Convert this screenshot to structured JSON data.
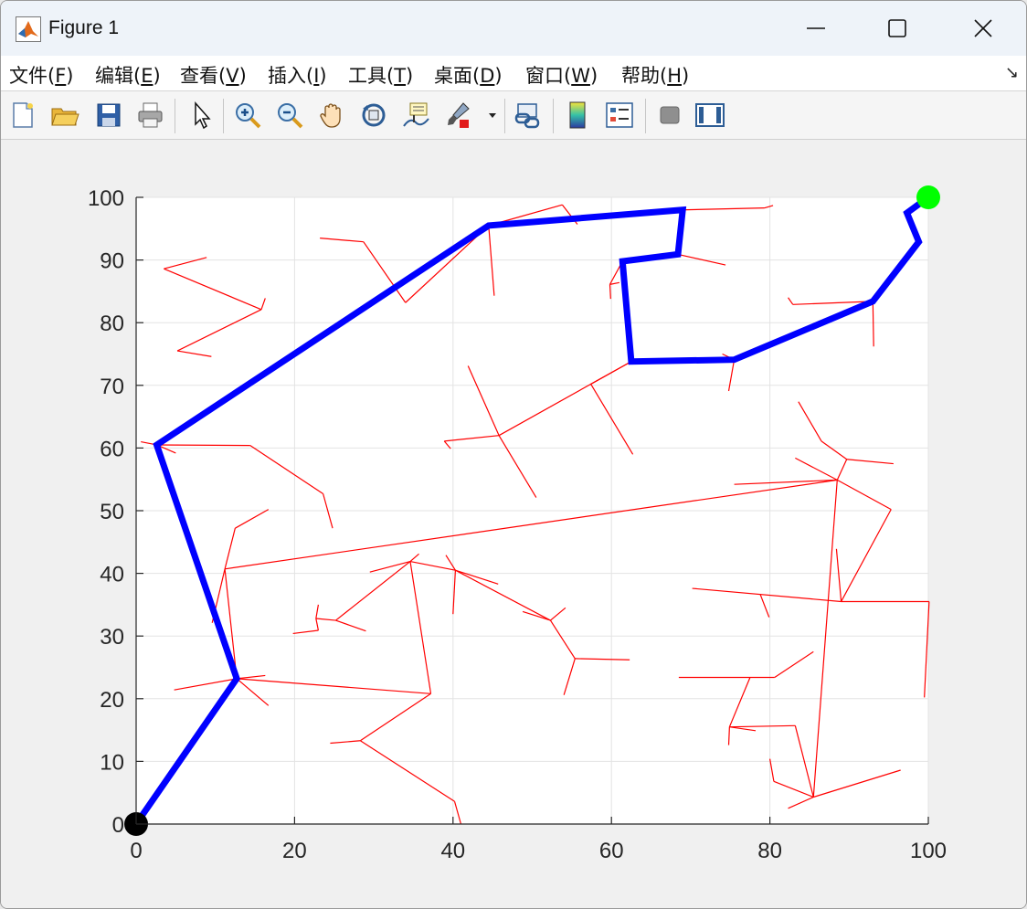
{
  "window": {
    "title": "Figure 1",
    "buttons": [
      "minimize",
      "maximize",
      "close"
    ]
  },
  "menu": [
    {
      "label": "文件(",
      "mnemonic": "F",
      "tail": ")"
    },
    {
      "label": "编辑(",
      "mnemonic": "E",
      "tail": ")"
    },
    {
      "label": "查看(",
      "mnemonic": "V",
      "tail": ")"
    },
    {
      "label": "插入(",
      "mnemonic": "I",
      "tail": ")"
    },
    {
      "label": "工具(",
      "mnemonic": "T",
      "tail": ")"
    },
    {
      "label": "桌面(",
      "mnemonic": "D",
      "tail": ")"
    },
    {
      "label": "窗口(",
      "mnemonic": "W",
      "tail": ")"
    },
    {
      "label": "帮助(",
      "mnemonic": "H",
      "tail": ")"
    }
  ],
  "toolbar_icons": [
    "new-figure-icon",
    "open-file-icon",
    "save-icon",
    "print-icon",
    "select-arrow-icon",
    "zoom-in-icon",
    "zoom-out-icon",
    "pan-hand-icon",
    "rotate-3d-icon",
    "data-cursor-icon",
    "brush-icon",
    "brush-dropdown-icon",
    "link-plot-icon",
    "colorbar-icon",
    "legend-icon",
    "hide-plot-tools-icon",
    "show-plot-tools-icon"
  ],
  "chart_data": {
    "type": "line",
    "xlim": [
      0,
      100
    ],
    "ylim": [
      0,
      100
    ],
    "xticks": [
      0,
      20,
      40,
      60,
      80,
      100
    ],
    "yticks": [
      0,
      10,
      20,
      30,
      40,
      50,
      60,
      70,
      80,
      90,
      100
    ],
    "grid": true,
    "tree_edges": [
      [
        [
          0,
          0
        ],
        [
          12.7,
          23.2
        ]
      ],
      [
        [
          12.7,
          23.2
        ],
        [
          11.2,
          40.7
        ]
      ],
      [
        [
          11.2,
          40.7
        ],
        [
          9.6,
          32.1
        ]
      ],
      [
        [
          11.2,
          40.7
        ],
        [
          12.5,
          47.2
        ]
      ],
      [
        [
          12.5,
          47.2
        ],
        [
          16.7,
          50.2
        ]
      ],
      [
        [
          11.2,
          40.7
        ],
        [
          88.5,
          54.9
        ]
      ],
      [
        [
          88.5,
          54.9
        ],
        [
          75.5,
          54.2
        ]
      ],
      [
        [
          88.5,
          54.9
        ],
        [
          83.2,
          58.4
        ]
      ],
      [
        [
          88.5,
          54.9
        ],
        [
          89.7,
          58.2
        ]
      ],
      [
        [
          89.7,
          58.2
        ],
        [
          95.6,
          57.5
        ]
      ],
      [
        [
          89.7,
          58.2
        ],
        [
          86.5,
          61.1
        ]
      ],
      [
        [
          86.5,
          61.1
        ],
        [
          83.6,
          67.4
        ]
      ],
      [
        [
          88.5,
          54.9
        ],
        [
          95.3,
          50.2
        ]
      ],
      [
        [
          95.3,
          50.2
        ],
        [
          89.0,
          35.5
        ]
      ],
      [
        [
          89.0,
          35.5
        ],
        [
          88.4,
          43.9
        ]
      ],
      [
        [
          89.0,
          35.5
        ],
        [
          70.2,
          37.6
        ]
      ],
      [
        [
          89.0,
          35.5
        ],
        [
          100.1,
          35.5
        ]
      ],
      [
        [
          100.1,
          35.5
        ],
        [
          99.5,
          20.2
        ]
      ],
      [
        [
          88.5,
          54.9
        ],
        [
          85.5,
          4.3
        ]
      ],
      [
        [
          85.5,
          4.3
        ],
        [
          96.5,
          8.6
        ]
      ],
      [
        [
          85.5,
          4.3
        ],
        [
          82.3,
          2.5
        ]
      ],
      [
        [
          85.5,
          4.3
        ],
        [
          80.5,
          6.8
        ]
      ],
      [
        [
          80.5,
          6.8
        ],
        [
          80.0,
          10.4
        ]
      ],
      [
        [
          85.5,
          4.3
        ],
        [
          83.2,
          15.7
        ]
      ],
      [
        [
          83.2,
          15.7
        ],
        [
          74.9,
          15.5
        ]
      ],
      [
        [
          74.9,
          15.5
        ],
        [
          78.2,
          14.9
        ]
      ],
      [
        [
          74.9,
          15.5
        ],
        [
          74.8,
          12.6
        ]
      ],
      [
        [
          74.9,
          15.5
        ],
        [
          77.5,
          23.4
        ]
      ],
      [
        [
          77.5,
          23.4
        ],
        [
          68.5,
          23.4
        ]
      ],
      [
        [
          77.5,
          23.4
        ],
        [
          80.6,
          23.4
        ]
      ],
      [
        [
          80.6,
          23.4
        ],
        [
          85.5,
          27.5
        ]
      ],
      [
        [
          78.8,
          36.6
        ],
        [
          79.9,
          33.0
        ]
      ],
      [
        [
          12.7,
          23.2
        ],
        [
          4.8,
          21.4
        ]
      ],
      [
        [
          12.7,
          23.2
        ],
        [
          16.3,
          23.7
        ]
      ],
      [
        [
          12.7,
          23.2
        ],
        [
          16.7,
          18.9
        ]
      ],
      [
        [
          12.7,
          23.2
        ],
        [
          37.2,
          20.8
        ]
      ],
      [
        [
          37.2,
          20.8
        ],
        [
          34.6,
          41.9
        ]
      ],
      [
        [
          34.6,
          41.9
        ],
        [
          29.5,
          40.2
        ]
      ],
      [
        [
          34.6,
          41.9
        ],
        [
          35.7,
          43.1
        ]
      ],
      [
        [
          34.6,
          41.9
        ],
        [
          25.2,
          32.5
        ]
      ],
      [
        [
          25.2,
          32.5
        ],
        [
          22.7,
          32.8
        ]
      ],
      [
        [
          22.7,
          32.8
        ],
        [
          23.0,
          35.0
        ]
      ],
      [
        [
          25.2,
          32.5
        ],
        [
          29.0,
          30.8
        ]
      ],
      [
        [
          22.7,
          32.8
        ],
        [
          23.0,
          30.9
        ]
      ],
      [
        [
          23.0,
          30.9
        ],
        [
          19.8,
          30.4
        ]
      ],
      [
        [
          34.6,
          41.9
        ],
        [
          40.3,
          40.5
        ]
      ],
      [
        [
          40.3,
          40.5
        ],
        [
          40.0,
          33.5
        ]
      ],
      [
        [
          40.3,
          40.5
        ],
        [
          39.1,
          42.9
        ]
      ],
      [
        [
          40.3,
          40.5
        ],
        [
          45.7,
          38.3
        ]
      ],
      [
        [
          40.3,
          40.5
        ],
        [
          52.3,
          32.5
        ]
      ],
      [
        [
          52.3,
          32.5
        ],
        [
          54.2,
          34.5
        ]
      ],
      [
        [
          52.3,
          32.5
        ],
        [
          48.8,
          33.9
        ]
      ],
      [
        [
          52.3,
          32.5
        ],
        [
          55.4,
          26.4
        ]
      ],
      [
        [
          55.4,
          26.4
        ],
        [
          62.3,
          26.2
        ]
      ],
      [
        [
          55.4,
          26.4
        ],
        [
          54.0,
          20.6
        ]
      ],
      [
        [
          37.2,
          20.8
        ],
        [
          28.3,
          13.3
        ]
      ],
      [
        [
          28.3,
          13.3
        ],
        [
          24.5,
          12.9
        ]
      ],
      [
        [
          28.3,
          13.3
        ],
        [
          40.2,
          3.6
        ]
      ],
      [
        [
          40.2,
          3.6
        ],
        [
          41.0,
          0
        ]
      ],
      [
        [
          2.6,
          60.5
        ],
        [
          0.6,
          61.0
        ]
      ],
      [
        [
          2.6,
          60.5
        ],
        [
          5.0,
          59.2
        ]
      ],
      [
        [
          2.6,
          60.5
        ],
        [
          14.4,
          60.4
        ]
      ],
      [
        [
          14.4,
          60.4
        ],
        [
          23.6,
          52.7
        ]
      ],
      [
        [
          23.6,
          52.7
        ],
        [
          24.8,
          47.2
        ]
      ],
      [
        [
          2.6,
          60.5
        ],
        [
          44.5,
          95.5
        ]
      ],
      [
        [
          15.8,
          82.1
        ],
        [
          3.5,
          88.6
        ]
      ],
      [
        [
          3.5,
          88.6
        ],
        [
          8.9,
          90.4
        ]
      ],
      [
        [
          15.8,
          82.1
        ],
        [
          5.2,
          75.5
        ]
      ],
      [
        [
          5.2,
          75.5
        ],
        [
          9.5,
          74.6
        ]
      ],
      [
        [
          15.8,
          82.1
        ],
        [
          16.3,
          83.9
        ]
      ],
      [
        [
          44.5,
          95.5
        ],
        [
          34.0,
          83.2
        ]
      ],
      [
        [
          34.0,
          83.2
        ],
        [
          28.7,
          92.9
        ]
      ],
      [
        [
          28.7,
          92.9
        ],
        [
          23.2,
          93.5
        ]
      ],
      [
        [
          44.5,
          95.5
        ],
        [
          45.2,
          84.3
        ]
      ],
      [
        [
          44.5,
          95.5
        ],
        [
          53.8,
          98.8
        ]
      ],
      [
        [
          53.8,
          98.8
        ],
        [
          55.7,
          95.7
        ]
      ],
      [
        [
          44.5,
          95.5
        ],
        [
          69.0,
          98.0
        ]
      ],
      [
        [
          69.0,
          98.0
        ],
        [
          79.3,
          98.3
        ]
      ],
      [
        [
          79.3,
          98.3
        ],
        [
          80.4,
          98.7
        ]
      ],
      [
        [
          69.0,
          98.0
        ],
        [
          68.4,
          90.9
        ]
      ],
      [
        [
          68.4,
          90.9
        ],
        [
          74.4,
          89.2
        ]
      ],
      [
        [
          68.4,
          90.9
        ],
        [
          61.4,
          89.8
        ]
      ],
      [
        [
          61.4,
          89.8
        ],
        [
          62.5,
          73.8
        ]
      ],
      [
        [
          61.4,
          89.8
        ],
        [
          59.8,
          86.1
        ]
      ],
      [
        [
          59.8,
          86.1
        ],
        [
          59.9,
          83.8
        ]
      ],
      [
        [
          59.8,
          86.1
        ],
        [
          61.0,
          86.4
        ]
      ],
      [
        [
          62.5,
          73.8
        ],
        [
          57.4,
          70.2
        ]
      ],
      [
        [
          57.4,
          70.2
        ],
        [
          62.7,
          59.0
        ]
      ],
      [
        [
          62.5,
          73.8
        ],
        [
          45.8,
          62.0
        ]
      ],
      [
        [
          45.8,
          62.0
        ],
        [
          41.9,
          73.1
        ]
      ],
      [
        [
          45.8,
          62.0
        ],
        [
          38.9,
          61.1
        ]
      ],
      [
        [
          38.9,
          61.1
        ],
        [
          39.7,
          59.9
        ]
      ],
      [
        [
          45.8,
          62.0
        ],
        [
          50.5,
          52.1
        ]
      ],
      [
        [
          62.5,
          73.8
        ],
        [
          75.5,
          74.1
        ]
      ],
      [
        [
          75.5,
          74.1
        ],
        [
          74.8,
          69.1
        ]
      ],
      [
        [
          75.5,
          74.1
        ],
        [
          74.0,
          75.0
        ]
      ],
      [
        [
          75.5,
          74.1
        ],
        [
          93.0,
          83.4
        ]
      ],
      [
        [
          93.0,
          83.4
        ],
        [
          82.9,
          82.9
        ]
      ],
      [
        [
          82.9,
          82.9
        ],
        [
          82.3,
          84.0
        ]
      ],
      [
        [
          93.0,
          83.4
        ],
        [
          93.1,
          76.2
        ]
      ],
      [
        [
          93.0,
          83.4
        ],
        [
          98.8,
          92.9
        ]
      ],
      [
        [
          98.8,
          92.9
        ],
        [
          97.3,
          97.5
        ]
      ],
      [
        [
          97.3,
          97.5
        ],
        [
          100,
          100
        ]
      ]
    ],
    "series": [
      {
        "color": "#0000ff",
        "x": [
          0,
          12.7,
          2.6,
          44.5,
          69.0,
          68.4,
          61.4,
          62.5,
          75.5,
          93.0,
          98.8,
          97.3,
          100
        ],
        "y": [
          0,
          23.2,
          60.5,
          95.5,
          98.0,
          90.9,
          89.8,
          73.8,
          74.1,
          83.4,
          92.9,
          97.5,
          100
        ]
      }
    ],
    "start": {
      "x": 0,
      "y": 0,
      "color": "#000000"
    },
    "goal": {
      "x": 100,
      "y": 100,
      "color": "#00ff00"
    },
    "colors": {
      "tree": "#ff0000",
      "path": "#0000ff"
    }
  }
}
